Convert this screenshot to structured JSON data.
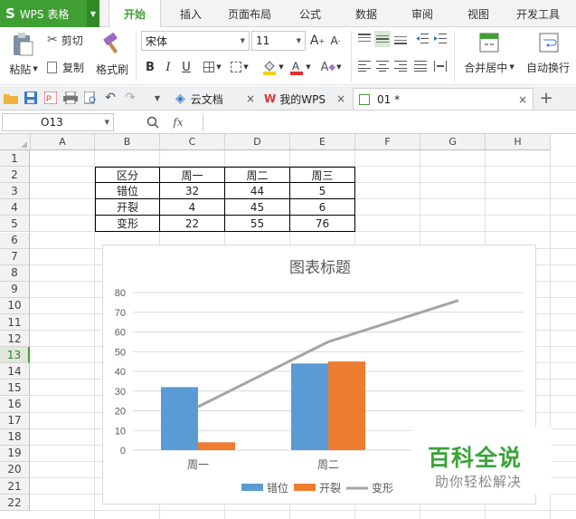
{
  "app": {
    "logo": "S",
    "name": "WPS 表格"
  },
  "ribbon_tabs": [
    {
      "label": "开始",
      "active": true
    },
    {
      "label": "插入"
    },
    {
      "label": "页面布局"
    },
    {
      "label": "公式"
    },
    {
      "label": "数据"
    },
    {
      "label": "审阅"
    },
    {
      "label": "视图"
    },
    {
      "label": "开发工具"
    }
  ],
  "ribbon": {
    "paste": "粘贴",
    "cut": "剪切",
    "copy": "复制",
    "format_painter": "格式刷",
    "font_name": "宋体",
    "font_size": "11",
    "merge_center": "合并居中",
    "wrap_text": "自动换行",
    "colors": {
      "font_color": "#e03030",
      "fill_color": "#f5d000",
      "accent": "#3f9f33"
    }
  },
  "doc_tabs": [
    {
      "label": "云文档",
      "icon": "cloud-icon"
    },
    {
      "label": "我的WPS",
      "icon": "wps-icon"
    },
    {
      "label": "01 *",
      "icon": "sheet-icon",
      "active": true
    }
  ],
  "formula_bar": {
    "name_box": "O13",
    "fx": "fx",
    "value": ""
  },
  "columns": [
    "A",
    "B",
    "C",
    "D",
    "E",
    "F",
    "G",
    "H"
  ],
  "rows": [
    "1",
    "2",
    "3",
    "4",
    "5",
    "6",
    "7",
    "8",
    "9",
    "10",
    "11",
    "12",
    "13",
    "14",
    "15",
    "16",
    "17",
    "18",
    "19",
    "20",
    "21",
    "22"
  ],
  "selected_row": "13",
  "table": {
    "header": [
      "区分",
      "周一",
      "周二",
      "周三"
    ],
    "rows": [
      [
        "错位",
        "32",
        "44",
        "5"
      ],
      [
        "开裂",
        "4",
        "45",
        "6"
      ],
      [
        "变形",
        "22",
        "55",
        "76"
      ]
    ]
  },
  "chart_data": {
    "type": "bar",
    "title": "图表标题",
    "categories": [
      "周一",
      "周二",
      "周三"
    ],
    "series": [
      {
        "name": "错位",
        "type": "bar",
        "color": "#5b9bd5",
        "values": [
          32,
          44,
          5
        ]
      },
      {
        "name": "开裂",
        "type": "bar",
        "color": "#ed7d31",
        "values": [
          4,
          45,
          6
        ]
      },
      {
        "name": "变形",
        "type": "line",
        "color": "#a5a5a5",
        "values": [
          22,
          55,
          76
        ]
      }
    ],
    "yticks": [
      "0",
      "10",
      "20",
      "30",
      "40",
      "50",
      "60",
      "70",
      "80"
    ],
    "ylim": [
      0,
      80
    ],
    "grid": true,
    "legend": "bottom"
  },
  "watermark": {
    "main": "百科全说",
    "sub": "助你轻松解决"
  }
}
